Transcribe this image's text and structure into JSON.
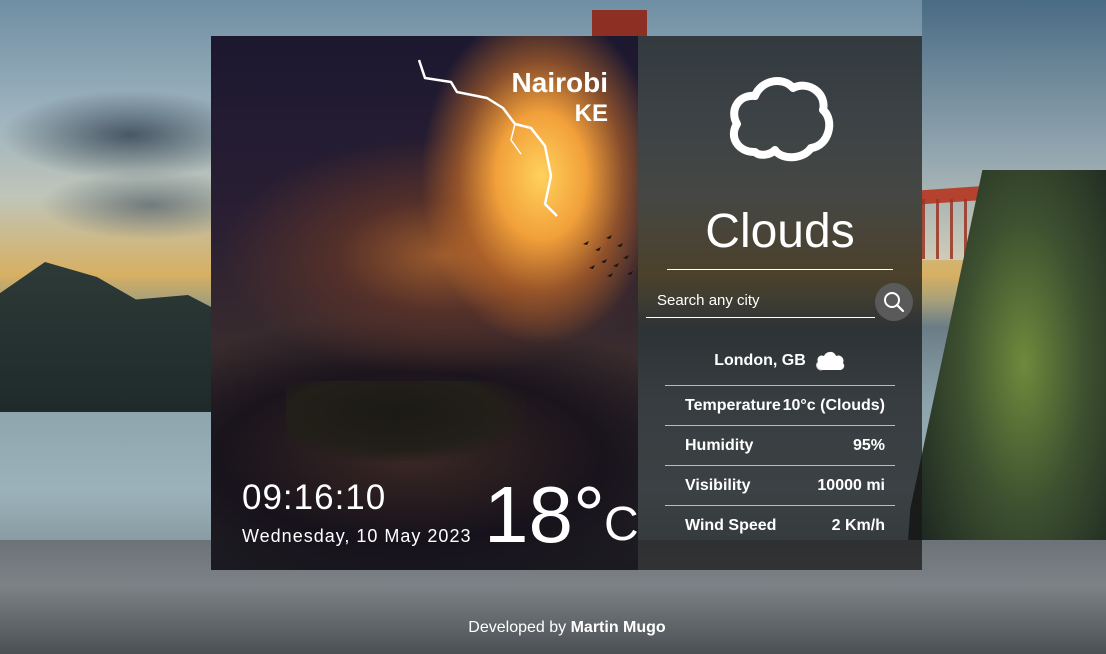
{
  "left_card": {
    "city": "Nairobi",
    "country": "KE",
    "time": "09:16:10",
    "date": "Wednesday, 10 May 2023",
    "temperature": "18°",
    "unit": "C"
  },
  "right_panel": {
    "condition_icon": "cloud-outline-icon",
    "condition": "Clouds",
    "search": {
      "placeholder": "Search any city",
      "value": ""
    },
    "search_button_icon": "search-icon",
    "location": "London, GB",
    "location_icon": "cloud-icon",
    "details": [
      {
        "label": "Temperature",
        "value": "10°c (Clouds)"
      },
      {
        "label": "Humidity",
        "value": "95%"
      },
      {
        "label": "Visibility",
        "value": "10000 mi"
      },
      {
        "label": "Wind Speed",
        "value": "2 Km/h"
      }
    ]
  },
  "footer": {
    "prefix": "Developed by",
    "author": "Martin Mugo"
  },
  "colors": {
    "panel_bg": "#161616",
    "text": "#ffffff",
    "search_button": "#5a5a5a"
  }
}
